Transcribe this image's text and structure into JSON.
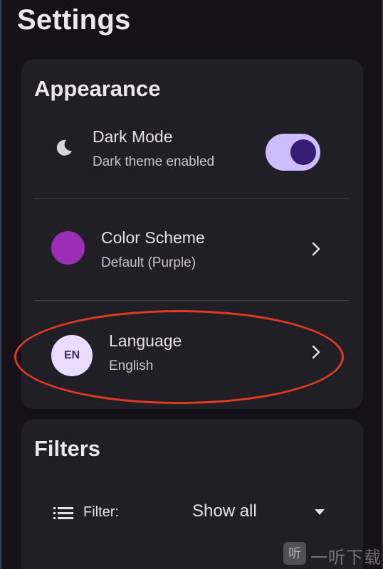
{
  "header": {
    "title": "Settings"
  },
  "appearance": {
    "title": "Appearance",
    "dark_mode": {
      "title": "Dark Mode",
      "subtitle": "Dark theme enabled",
      "enabled": true,
      "icon": "moon-icon"
    },
    "color_scheme": {
      "title": "Color Scheme",
      "subtitle": "Default (Purple)",
      "swatch_color": "#9a2eb6",
      "icon": "chevron-right-icon"
    },
    "language": {
      "title": "Language",
      "subtitle": "English",
      "badge": "EN",
      "icon": "chevron-right-icon"
    }
  },
  "filters": {
    "title": "Filters",
    "filter_label": "Filter:",
    "filter_value": "Show all",
    "icons": [
      "filter-list-icon",
      "dropdown-arrow-icon"
    ]
  },
  "watermark": {
    "glyph": "听",
    "text": "一听下载"
  },
  "colors": {
    "background": "#141218",
    "card": "#211f26",
    "accent": "#cfbcff",
    "accent_dark": "#381e72",
    "annotation": "#e43a22"
  }
}
